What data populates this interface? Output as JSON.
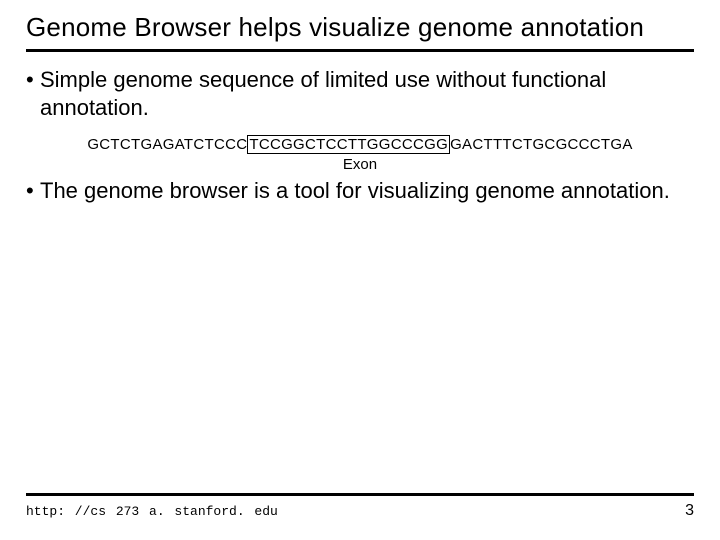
{
  "title": "Genome Browser helps visualize genome annotation",
  "bullets": [
    "Simple genome sequence of limited use without functional annotation.",
    "The genome browser is a tool for visualizing genome annotation."
  ],
  "sequence": {
    "pre": "GCTCTGAGATCTCCC",
    "boxed": "TCCGGCTCCTTGGCCCGG",
    "post": "GACTTTCTGCGCCCTGA"
  },
  "exon_label": "Exon",
  "footer": {
    "url": "http: //cs 273 a. stanford. edu",
    "page": "3"
  }
}
